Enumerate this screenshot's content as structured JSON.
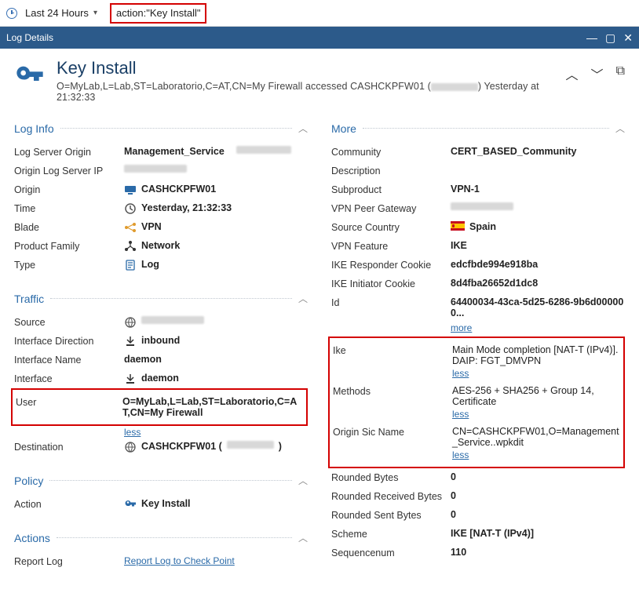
{
  "topbar": {
    "time_range": "Last 24 Hours",
    "search_query": "action:\"Key Install\""
  },
  "titlebar": {
    "title": "Log Details"
  },
  "header": {
    "title": "Key Install",
    "subtitle_prefix": "O=MyLab,L=Lab,ST=Laboratorio,C=AT,CN=My Firewall accessed CASHCKPFW01 (",
    "subtitle_suffix": ") Yesterday at  21:32:33"
  },
  "sections": {
    "log_info": {
      "title": "Log Info",
      "rows": {
        "log_server_origin": {
          "label": "Log Server Origin",
          "value": "Management_Service"
        },
        "origin_log_server_ip": {
          "label": "Origin Log Server IP",
          "value": ""
        },
        "origin": {
          "label": "Origin",
          "value": "CASHCKPFW01"
        },
        "time": {
          "label": "Time",
          "value": "Yesterday, 21:32:33"
        },
        "blade": {
          "label": "Blade",
          "value": "VPN"
        },
        "product_family": {
          "label": "Product Family",
          "value": "Network"
        },
        "type": {
          "label": "Type",
          "value": "Log"
        }
      }
    },
    "traffic": {
      "title": "Traffic",
      "rows": {
        "source": {
          "label": "Source",
          "value": ""
        },
        "interface_direction": {
          "label": "Interface Direction",
          "value": "inbound"
        },
        "interface_name": {
          "label": "Interface Name",
          "value": "daemon"
        },
        "interface": {
          "label": "Interface",
          "value": "daemon"
        },
        "user": {
          "label": "User",
          "value": "O=MyLab,L=Lab,ST=Laboratorio,C=AT,CN=My Firewall"
        },
        "destination": {
          "label": "Destination",
          "value": "CASHCKPFW01 (",
          "suffix": ")"
        }
      },
      "less": "less"
    },
    "policy": {
      "title": "Policy",
      "rows": {
        "action": {
          "label": "Action",
          "value": "Key Install"
        }
      }
    },
    "actions": {
      "title": "Actions",
      "rows": {
        "report_log": {
          "label": "Report Log",
          "link": "Report Log to Check Point"
        }
      }
    },
    "more": {
      "title": "More",
      "rows": {
        "community": {
          "label": "Community",
          "value": "CERT_BASED_Community"
        },
        "description": {
          "label": "Description",
          "value": ""
        },
        "subproduct": {
          "label": "Subproduct",
          "value": "VPN-1"
        },
        "vpn_peer_gateway": {
          "label": "VPN Peer Gateway",
          "value": ""
        },
        "source_country": {
          "label": "Source Country",
          "value": "Spain"
        },
        "vpn_feature": {
          "label": "VPN Feature",
          "value": "IKE"
        },
        "ike_responder_cookie": {
          "label": "IKE Responder Cookie",
          "value": "edcfbde994e918ba"
        },
        "ike_initiator_cookie": {
          "label": "IKE Initiator Cookie",
          "value": "8d4fba26652d1dc8"
        },
        "id": {
          "label": "Id",
          "value": "64400034-43ca-5d25-6286-9b6d000000..."
        },
        "ike": {
          "label": "Ike",
          "value": "Main Mode completion [NAT-T (IPv4)]. DAIP: FGT_DMVPN"
        },
        "methods": {
          "label": "Methods",
          "value": "AES-256 + SHA256 + Group 14, Certificate"
        },
        "origin_sic_name": {
          "label": "Origin Sic Name",
          "value": "CN=CASHCKPFW01,O=Management_Service..wpkdit"
        },
        "rounded_bytes": {
          "label": "Rounded Bytes",
          "value": "0"
        },
        "rounded_received_bytes": {
          "label": "Rounded Received Bytes",
          "value": "0"
        },
        "rounded_sent_bytes": {
          "label": "Rounded Sent Bytes",
          "value": "0"
        },
        "scheme": {
          "label": "Scheme",
          "value": "IKE [NAT-T (IPv4)]"
        },
        "sequencenum": {
          "label": "Sequencenum",
          "value": "110"
        }
      },
      "more": "more",
      "less": "less"
    }
  }
}
